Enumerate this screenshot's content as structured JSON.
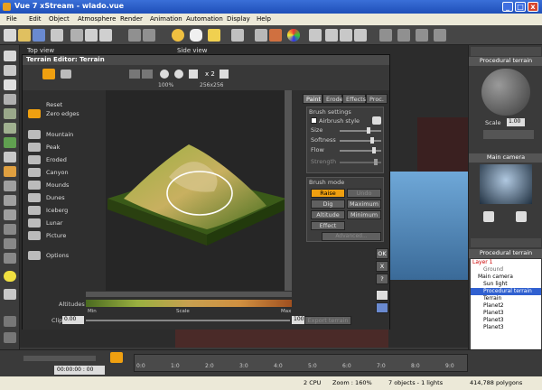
{
  "window": {
    "title": "Vue 7 xStream - wlado.vue",
    "min": "_",
    "max": "□",
    "close": "x"
  },
  "menu": [
    "File",
    "Edit",
    "Object",
    "Atmosphere",
    "Render",
    "Animation",
    "Automation",
    "Display",
    "Help"
  ],
  "views": {
    "top": "Top view",
    "side": "Side view"
  },
  "terrain_editor": {
    "title": "Terrain Editor: Terrain",
    "zoom": "100%",
    "resolution": "256x256",
    "scale_x2": "x 2",
    "side_items": [
      "Reset",
      "Zero edges",
      "Mountain",
      "Peak",
      "Eroded",
      "Canyon",
      "Mounds",
      "Dunes",
      "Iceberg",
      "Lunar",
      "Picture",
      "Options"
    ],
    "tabs": [
      "Paint",
      "Erode",
      "Effects",
      "Proc."
    ],
    "brush_settings": {
      "label": "Brush settings",
      "airbrush": "Airbrush style",
      "sliders": [
        "Size",
        "Softness",
        "Flow",
        "Strength"
      ]
    },
    "brush_mode": {
      "label": "Brush mode",
      "buttons": [
        "Raise",
        "Undo",
        "Dig",
        "Maximum",
        "Altitude",
        "Minimum",
        "Effect"
      ],
      "dropdown": "Advanced...",
      "active": "Raise"
    },
    "altitudes_label": "Altitudes",
    "altitudes_min": "Min",
    "altitudes_scale": "Scale",
    "altitudes_max": "Max",
    "clip_label": "Clip",
    "clip_min": "0.00",
    "clip_max": "100.0",
    "export_button": "Export terrain",
    "side_buttons": [
      "OK",
      "X",
      "?"
    ]
  },
  "right_panel": {
    "material_header": "Procedural terrain",
    "scale_label": "Scale",
    "scale_value": "1.00",
    "camera_header": "Main camera",
    "scene_header": "Procedural terrain",
    "scene_items": [
      "Layer 1",
      "Ground",
      "Main camera",
      "Sun light",
      "Procedural terrain",
      "Terrain",
      "Planet2",
      "Planet3",
      "Planet3",
      "Planet3"
    ],
    "selected_item": "Procedural terrain"
  },
  "timeline": {
    "current_time": "00:00:00 : 00",
    "ticks": [
      "0:0",
      "1:0",
      "2:0",
      "3:0",
      "4:0",
      "5:0",
      "6:0",
      "7:0",
      "8:0",
      "9:0"
    ]
  },
  "status": {
    "cpu": "2 CPU",
    "zoom": "Zoom : 160%",
    "objects": "7 objects - 1 lights",
    "polygons": "414,788 polygons"
  },
  "colors": {
    "accent": "#f0a010",
    "titlebar": "#2a5bd0",
    "selection": "#3060d0"
  }
}
